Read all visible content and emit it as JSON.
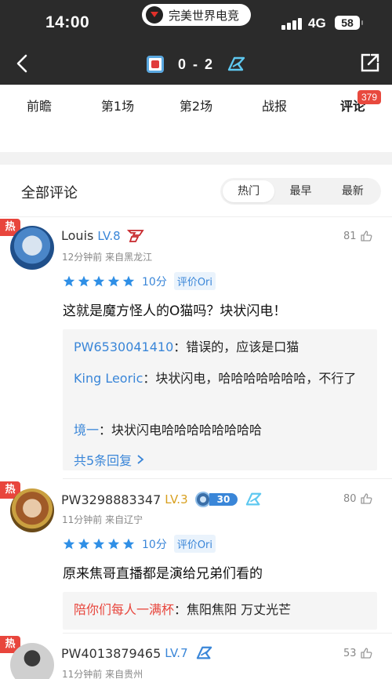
{
  "status": {
    "time": "14:00",
    "app_pill": "完美世界电竞",
    "network": "4G",
    "battery": "58"
  },
  "header": {
    "score": "0 - 2"
  },
  "tabs": [
    "前瞻",
    "第1场",
    "第2场",
    "战报",
    "评论"
  ],
  "comment_count_badge": "379",
  "comments_section": {
    "title": "全部评论",
    "sort": [
      "热门",
      "最早",
      "最新"
    ]
  },
  "hot_label": "热",
  "comments": [
    {
      "user": "Louis",
      "level": "LV.8",
      "meta": "12分钟前  来自黑龙江",
      "likes": "81",
      "rating": "10分",
      "rating_target": "评价Ori",
      "text": "这就是魔方怪人的O猫吗？块状闪电！",
      "replies": [
        {
          "user": "PW6530041410",
          "text": "：错误的，应该是口猫"
        },
        {
          "user": "King Leoric",
          "text": "：块状闪电，哈哈哈哈哈哈哈，不行了"
        },
        {
          "user": "境一",
          "text": "：块状闪电哈哈哈哈哈哈哈哈"
        }
      ],
      "more": "共5条回复"
    },
    {
      "user": "PW3298883347",
      "level": "LV.3",
      "medal_num": "30",
      "meta": "11分钟前  来自辽宁",
      "likes": "80",
      "rating": "10分",
      "rating_target": "评价Ori",
      "text": "原来焦哥直播都是演给兄弟们看的",
      "replies": [
        {
          "user": "陪你们每人一满杯",
          "text": "：焦阳焦阳 万丈光芒"
        }
      ]
    },
    {
      "user": "PW4013879465",
      "level": "LV.7",
      "meta": "11分钟前  来自贵州",
      "likes": "53"
    }
  ],
  "colors": {
    "accent": "#3a86d8",
    "hot": "#e8453c",
    "star": "#2f8fe6",
    "header_bg": "#2b2b2b"
  }
}
